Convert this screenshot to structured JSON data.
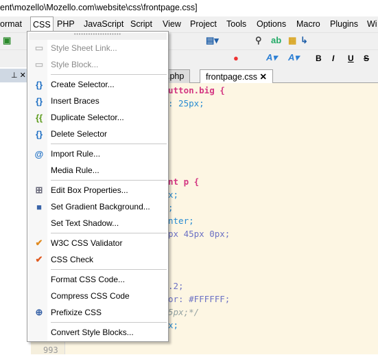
{
  "window": {
    "title": "ent\\mozello\\Mozello.com\\website\\css\\frontpage.css]"
  },
  "menubar": [
    "ormat",
    "CSS",
    "PHP",
    "JavaScript",
    "Script",
    "View",
    "Project",
    "Tools",
    "Options",
    "Macro",
    "Plugins",
    "Wi"
  ],
  "tabs": [
    ".php",
    "frontpage.css"
  ],
  "tab_close": "✕",
  "left_panel": {
    "pin": "⊥",
    "close": "✕"
  },
  "gutter": {
    "last_line": "993"
  },
  "code_lines": [
    {
      "text": "utton.big {",
      "color": "#d33682"
    },
    {
      "text": ": 25px;",
      "color": "#268bd2"
    },
    {
      "text": "",
      "color": "#000"
    },
    {
      "text": "",
      "color": "#000"
    },
    {
      "text": "",
      "color": "#000"
    },
    {
      "text": "",
      "color": "#000"
    },
    {
      "text": "",
      "color": "#000"
    },
    {
      "text": "nt p {",
      "color": "#d33682"
    },
    {
      "text": "x;",
      "color": "#268bd2"
    },
    {
      "text": ";",
      "color": "#268bd2"
    },
    {
      "text": "nter;",
      "color": "#268bd2"
    },
    {
      "text": "px 45px 0px;",
      "color": "#6c71c4"
    },
    {
      "text": "",
      "color": "#000"
    },
    {
      "text": "",
      "color": "#000"
    },
    {
      "text": "",
      "color": "#000"
    },
    {
      "text": ".2;",
      "color": "#6c71c4"
    },
    {
      "text": "or: #FFFFFF;",
      "color": "#6c71c4"
    },
    {
      "text": "5px;*/",
      "color": "#93a1a1"
    },
    {
      "text": "x;",
      "color": "#268bd2"
    }
  ],
  "css_menu": {
    "groups": [
      [
        {
          "label": "Style Sheet Link...",
          "icon": "stylesheet-link-icon",
          "disabled": true
        },
        {
          "label": "Style Block...",
          "icon": "style-block-icon",
          "disabled": true
        }
      ],
      [
        {
          "label": "Create Selector...",
          "icon": "create-selector-icon"
        },
        {
          "label": "Insert Braces",
          "icon": "braces-icon"
        },
        {
          "label": "Duplicate Selector...",
          "icon": "duplicate-selector-icon"
        },
        {
          "label": "Delete Selector",
          "icon": "delete-selector-icon"
        }
      ],
      [
        {
          "label": "Import Rule...",
          "icon": "at-icon"
        },
        {
          "label": "Media Rule...",
          "icon": ""
        }
      ],
      [
        {
          "label": "Edit Box Properties...",
          "icon": "box-properties-icon"
        },
        {
          "label": "Set Gradient Background...",
          "icon": "gradient-icon"
        },
        {
          "label": "Set Text Shadow...",
          "icon": ""
        }
      ],
      [
        {
          "label": "W3C CSS Validator",
          "icon": "css-validator-icon"
        },
        {
          "label": "CSS Check",
          "icon": "css-check-icon"
        }
      ],
      [
        {
          "label": "Format CSS Code...",
          "icon": ""
        },
        {
          "label": "Compress CSS Code",
          "icon": ""
        },
        {
          "label": "Prefixize CSS",
          "icon": "prefixize-icon"
        }
      ],
      [
        {
          "label": "Convert Style Blocks...",
          "icon": ""
        }
      ]
    ]
  },
  "colors": {
    "editor_bg": "#fdf6e3",
    "selector": "#d33682",
    "value": "#268bd2"
  }
}
